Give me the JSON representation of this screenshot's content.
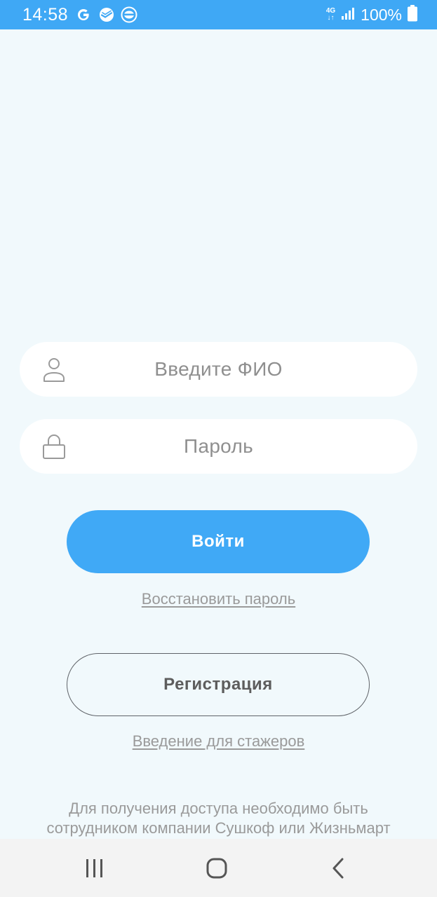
{
  "status_bar": {
    "time": "14:58",
    "left_icons": [
      "google-g-icon",
      "sber-icon",
      "burger-king-icon"
    ],
    "network": {
      "top": "4G",
      "bottom": "↓↑"
    },
    "battery_percent": "100%",
    "background": "#3fa8f5"
  },
  "login_form": {
    "name_field": {
      "placeholder": "Введите ФИО",
      "value": "",
      "icon": "person-icon"
    },
    "password_field": {
      "placeholder": "Пароль",
      "value": "",
      "icon": "lock-icon"
    },
    "login_button_label": "Войти",
    "restore_password_link": "Восстановить пароль",
    "register_button_label": "Регистрация",
    "interns_link": "Введение для стажеров",
    "notice_line_1": "Для получения доступа необходимо быть",
    "notice_line_2": "сотрудником компании Сушкоф или Жизньмарт"
  },
  "nav_bar": {
    "items": [
      "recent-apps-icon",
      "home-icon",
      "back-icon"
    ]
  },
  "colors": {
    "accent": "#40a9f6",
    "page_background": "#f1f9fc",
    "muted_text": "#9a9a9a"
  }
}
